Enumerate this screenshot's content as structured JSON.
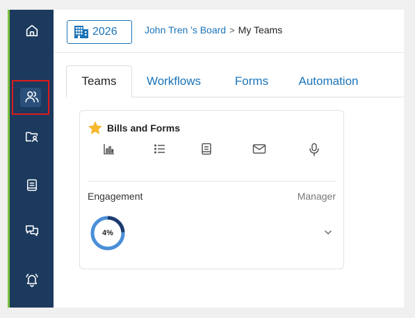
{
  "sidebar": {
    "items": [
      {
        "icon": "home-icon"
      },
      {
        "icon": "users-icon",
        "active": true
      },
      {
        "icon": "folder-user-icon"
      },
      {
        "icon": "book-icon"
      },
      {
        "icon": "chat-icon"
      },
      {
        "icon": "bell-icon"
      }
    ],
    "accent_color": "#7cc142",
    "background": "#1c3a5e"
  },
  "header": {
    "year_label": "2026",
    "breadcrumb": {
      "board": "John Tren 's Board",
      "separator": ">",
      "current": "My Teams"
    }
  },
  "tabs": [
    {
      "label": "Teams",
      "active": true
    },
    {
      "label": "Workflows"
    },
    {
      "label": "Forms"
    },
    {
      "label": "Automation"
    }
  ],
  "card": {
    "title": "Bills and Forms",
    "actions": [
      "chart-icon",
      "list-icon",
      "document-icon",
      "mail-icon",
      "microphone-icon"
    ],
    "left_label": "Engagement",
    "right_label": "Manager",
    "progress_text": "4%",
    "progress_value": 0.04
  },
  "colors": {
    "link": "#1a73b8",
    "highlight": "#e01a1a",
    "star": "#f5b82e"
  }
}
